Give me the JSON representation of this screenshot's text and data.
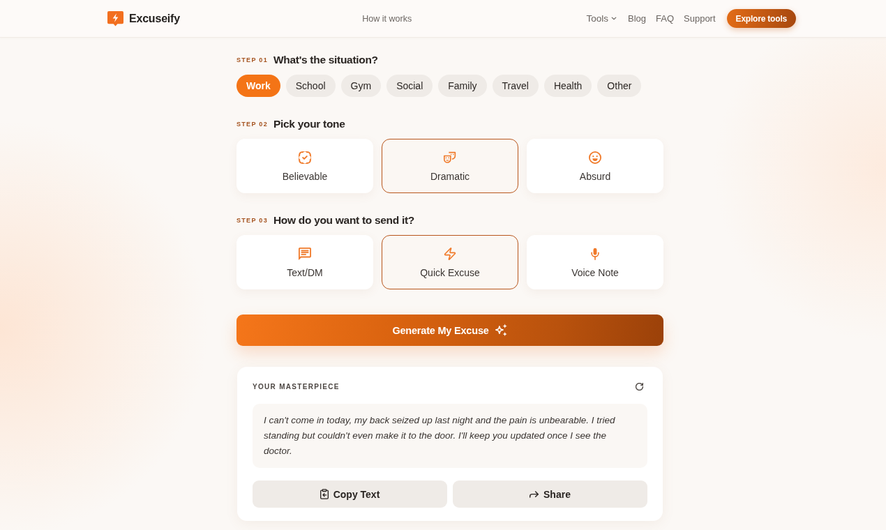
{
  "header": {
    "brand": "Excuseify",
    "center_link": "How it works",
    "nav": [
      {
        "label": "Tools",
        "dropdown": true
      },
      {
        "label": "Blog",
        "dropdown": false
      },
      {
        "label": "FAQ",
        "dropdown": false
      },
      {
        "label": "Support",
        "dropdown": false
      }
    ],
    "cta": "Explore tools"
  },
  "steps": [
    {
      "number": "STEP 01",
      "title": "What's the situation?",
      "kind": "chips",
      "options": [
        {
          "label": "Work",
          "selected": true
        },
        {
          "label": "School",
          "selected": false
        },
        {
          "label": "Gym",
          "selected": false
        },
        {
          "label": "Social",
          "selected": false
        },
        {
          "label": "Family",
          "selected": false
        },
        {
          "label": "Travel",
          "selected": false
        },
        {
          "label": "Health",
          "selected": false
        },
        {
          "label": "Other",
          "selected": false
        }
      ]
    },
    {
      "number": "STEP 02",
      "title": "Pick your tone",
      "kind": "cards",
      "options": [
        {
          "label": "Believable",
          "selected": false
        },
        {
          "label": "Dramatic",
          "selected": true
        },
        {
          "label": "Absurd",
          "selected": false
        }
      ]
    },
    {
      "number": "STEP 03",
      "title": "How do you want to send it?",
      "kind": "cards",
      "options": [
        {
          "label": "Text/DM",
          "selected": false
        },
        {
          "label": "Quick Excuse",
          "selected": true
        },
        {
          "label": "Voice Note",
          "selected": false
        }
      ]
    }
  ],
  "generate_button": "Generate My Excuse",
  "result": {
    "title": "YOUR MASTERPIECE",
    "text": "I can't come in today, my back seized up last night and the pain is unbearable. I tried standing but couldn't even make it to the door. I'll keep you updated once I see the doctor.",
    "actions": [
      {
        "label": "Copy Text"
      },
      {
        "label": "Share"
      }
    ]
  }
}
